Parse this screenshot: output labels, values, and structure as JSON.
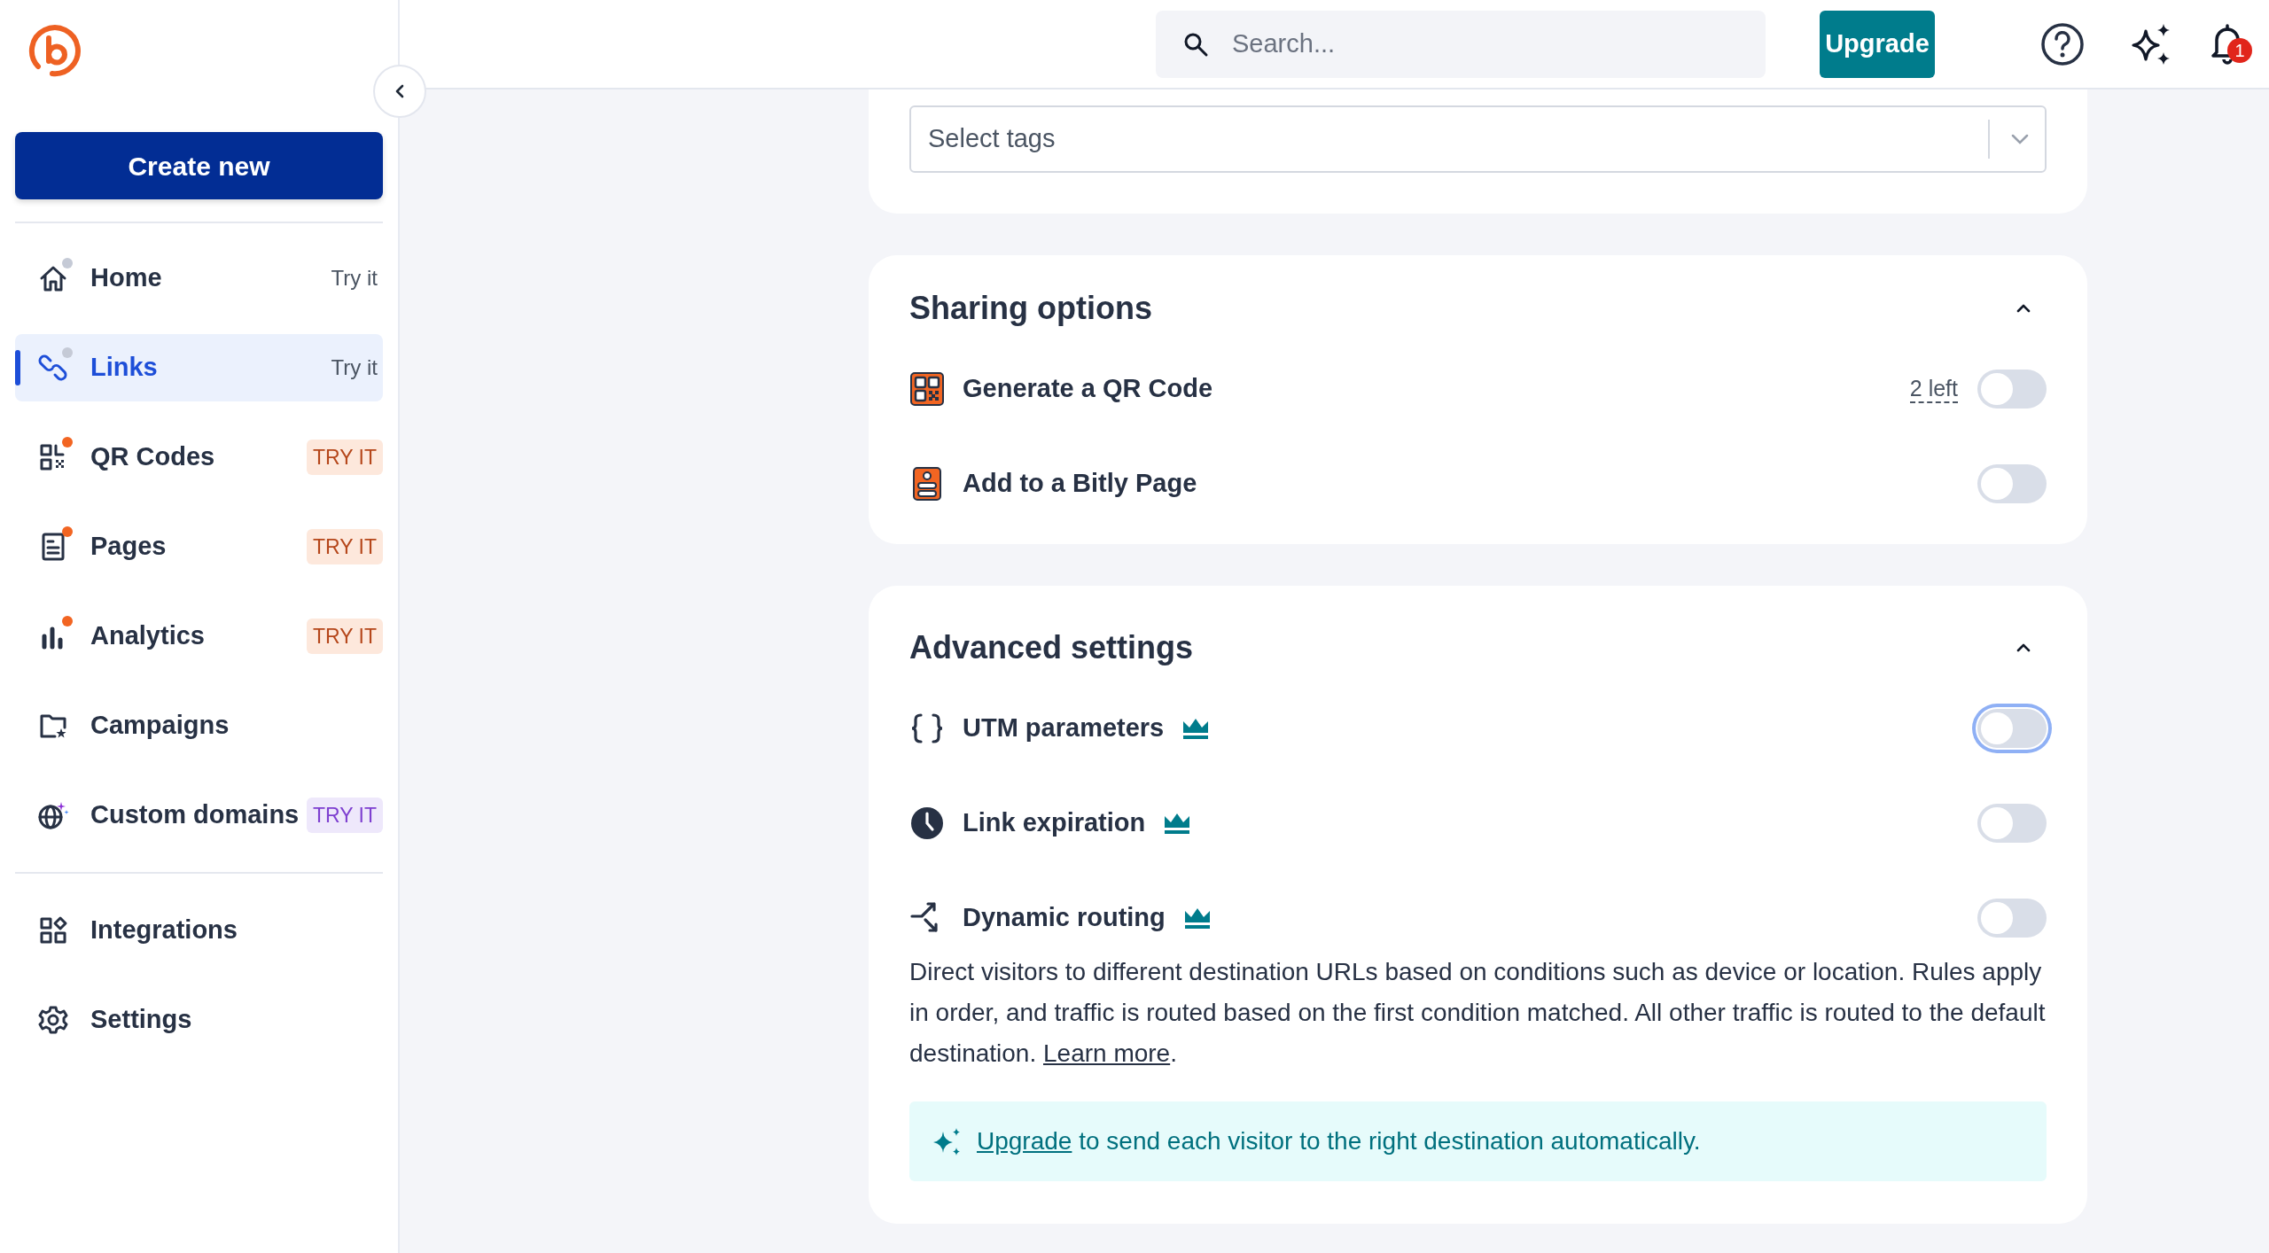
{
  "sidebar": {
    "create_button": "Create new",
    "nav_items": [
      {
        "label": "Home",
        "badge": "Try it",
        "kind": "plain",
        "color": "#c5cad6",
        "selected": false
      },
      {
        "label": "Links",
        "badge": "Try it",
        "kind": "plain",
        "color": "#c5cad6",
        "selected": true
      },
      {
        "label": "QR Codes",
        "badge": "TRY IT",
        "kind": "orange",
        "color": "#f26522",
        "selected": false
      },
      {
        "label": "Pages",
        "badge": "TRY IT",
        "kind": "orange",
        "color": "#f26522",
        "selected": false
      },
      {
        "label": "Analytics",
        "badge": "TRY IT",
        "kind": "orange",
        "color": "#f26522",
        "selected": false
      },
      {
        "label": "Campaigns",
        "selected": false
      },
      {
        "label": "Custom domains",
        "badge": "TRY IT",
        "kind": "purple",
        "selected": false
      }
    ],
    "bottom_items": [
      {
        "label": "Integrations",
        "selected": false
      },
      {
        "label": "Settings",
        "selected": false
      }
    ]
  },
  "top_bar": {
    "search": {
      "placeholder": "Search..."
    },
    "upgrade_button": "Upgrade",
    "notification_count": "1"
  },
  "tags_card": {
    "select": {
      "placeholder": "Select tags"
    }
  },
  "sharing_options": {
    "title": "Sharing options",
    "expanded": true,
    "rows": [
      {
        "label": "Generate a QR Code",
        "note": "2 left",
        "on": false
      },
      {
        "label": "Add to a Bitly Page",
        "on": false
      }
    ]
  },
  "advanced_settings": {
    "title": "Advanced settings",
    "expanded": true,
    "rows": [
      {
        "label": "UTM parameters",
        "premium": true,
        "on": false,
        "focused": true
      },
      {
        "label": "Link expiration",
        "premium": true,
        "on": false,
        "focused": false
      },
      {
        "label": "Dynamic routing",
        "premium": true,
        "on": false,
        "focused": false
      }
    ],
    "description": {
      "text": "Direct visitors to different destination URLs based on conditions such as device or location. Rules apply in order, and traffic is routed based on the first condition matched. All other traffic is routed to the default destination. ",
      "link": "Learn more",
      "after": "."
    },
    "banner": {
      "link": "Upgrade",
      "text": " to send each visitor to the right destination automatically."
    }
  }
}
